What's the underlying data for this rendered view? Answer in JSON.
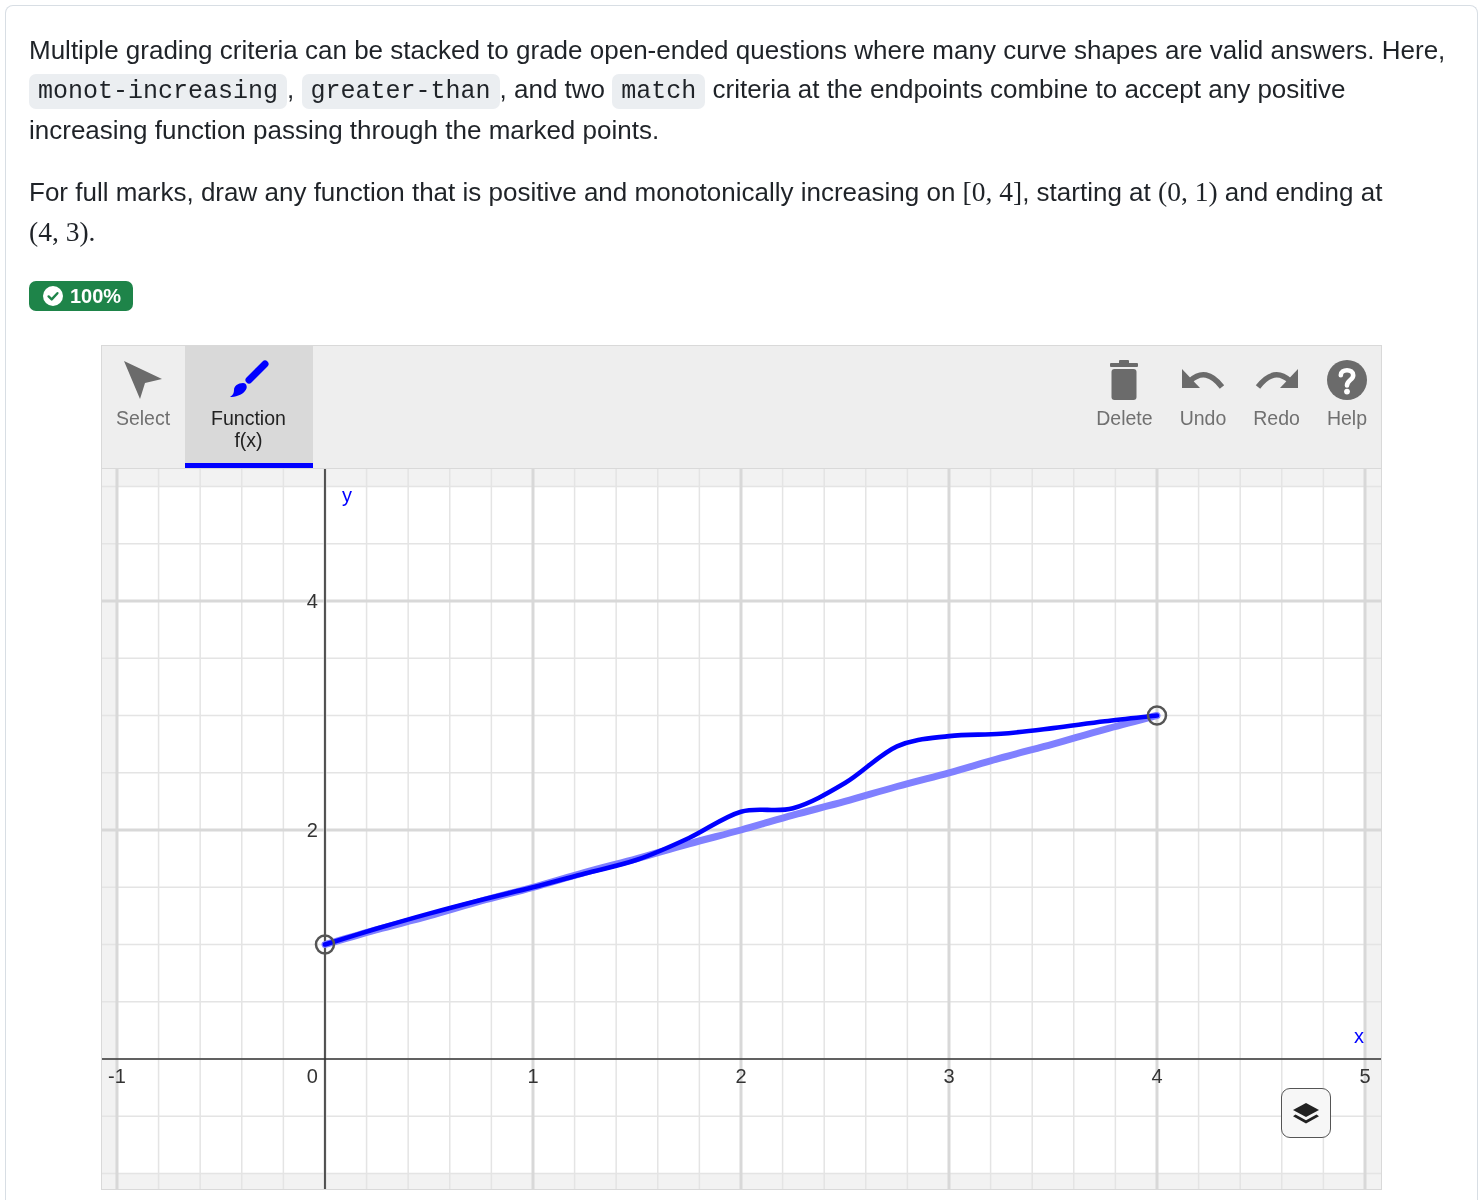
{
  "intro": [
    {
      "kind": "text",
      "text": "Multiple grading criteria can be stacked to grade open-ended questions where many curve shapes are valid answers. Here, "
    },
    {
      "kind": "code",
      "text": "monot-increasing"
    },
    {
      "kind": "text",
      "text": ", "
    },
    {
      "kind": "code",
      "text": "greater-than"
    },
    {
      "kind": "text",
      "text": ", and two "
    },
    {
      "kind": "code",
      "text": "match"
    },
    {
      "kind": "text",
      "text": " criteria at the endpoints combine to accept any positive increasing function passing through the marked points."
    }
  ],
  "task": [
    {
      "kind": "text",
      "text": "For full marks, draw any function that is positive and monotonically increasing on "
    },
    {
      "kind": "math",
      "text": "[0, 4]"
    },
    {
      "kind": "text",
      "text": ", starting at "
    },
    {
      "kind": "math",
      "text": "(0, 1)"
    },
    {
      "kind": "text",
      "text": " and ending at "
    },
    {
      "kind": "math",
      "text": "(4, 3)."
    }
  ],
  "score_badge": {
    "text": "100%"
  },
  "widget": {
    "tools": [
      {
        "kind": "select",
        "label": "Select",
        "selected": false
      },
      {
        "kind": "function",
        "label": "Function",
        "sublabel": "f(x)",
        "selected": true
      }
    ],
    "actions": [
      {
        "kind": "delete",
        "label": "Delete"
      },
      {
        "kind": "undo",
        "label": "Undo"
      },
      {
        "kind": "redo",
        "label": "Redo"
      },
      {
        "kind": "help",
        "label": "Help"
      }
    ],
    "plot": {
      "chart_data": {
        "type": "line",
        "xlabel": "x",
        "ylabel": "y",
        "x": [
          0,
          0.25,
          0.5,
          0.75,
          1,
          1.25,
          1.5,
          1.75,
          2,
          2.25,
          2.5,
          2.75,
          3,
          3.25,
          3.5,
          3.75,
          4
        ],
        "series": [
          {
            "color": "#8080ff",
            "values": [
              1,
              1.13,
              1.25,
              1.38,
              1.5,
              1.63,
              1.75,
              1.88,
              2,
              2.13,
              2.25,
              2.38,
              2.5,
              2.63,
              2.75,
              2.88,
              3
            ]
          },
          {
            "color": "#0000ff",
            "values": [
              1,
              1.14,
              1.27,
              1.39,
              1.5,
              1.62,
              1.74,
              1.93,
              2.16,
              2.19,
              2.41,
              2.73,
              2.82,
              2.84,
              2.89,
              2.95,
              3
            ]
          }
        ],
        "xlim": [
          -1.072,
          5.077
        ],
        "ylim": [
          -1.135,
          5.153
        ],
        "xticks": [
          -1,
          0,
          1,
          2,
          3,
          4,
          5
        ],
        "yticks": [
          2,
          4
        ],
        "grid": true
      }
    }
  }
}
